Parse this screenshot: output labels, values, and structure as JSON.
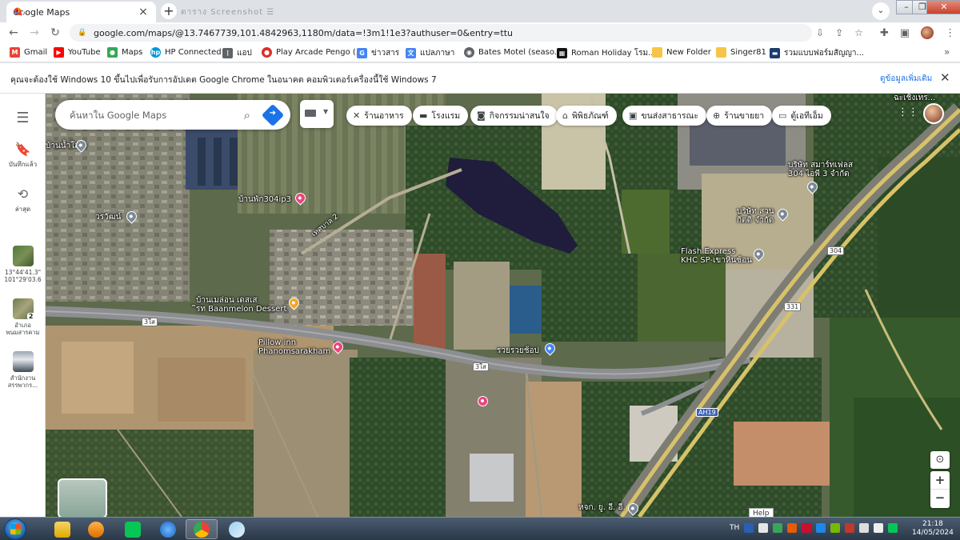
{
  "browser": {
    "tab_title": "Google Maps",
    "url": "google.com/maps/@13.7467739,101.4842963,1180m/data=!3m1!1e3?authuser=0&entry=ttu",
    "ghost_tabs": "ตาราง   Screenshot   ☰"
  },
  "bookmarks": [
    {
      "label": "Gmail",
      "icon": "gmail-icon",
      "color": "#ea4335",
      "glyph": "M"
    },
    {
      "label": "YouTube",
      "icon": "youtube-icon",
      "color": "#ff0000",
      "glyph": "▶"
    },
    {
      "label": "Maps",
      "icon": "maps-icon",
      "color": "#34a853",
      "glyph": "●"
    },
    {
      "label": "HP Connected",
      "icon": "hp-icon",
      "color": "#0096d6",
      "glyph": "hp"
    },
    {
      "label": "แอป",
      "icon": "apps-grid-icon",
      "color": "#5f6368",
      "glyph": "⋮"
    },
    {
      "label": "Play Arcade Pengo (...",
      "icon": "arcade-icon",
      "color": "#d93025",
      "glyph": "●"
    },
    {
      "label": "ข่าวสาร",
      "icon": "news-icon",
      "color": "#4285f4",
      "glyph": "G"
    },
    {
      "label": "แปลภาษา",
      "icon": "translate-icon",
      "color": "#4285f4",
      "glyph": "文"
    },
    {
      "label": "Bates Motel (seaso...",
      "icon": "globe-icon",
      "color": "#5f6368",
      "glyph": "◉"
    },
    {
      "label": "Roman Holiday โรม...",
      "icon": "imdb-icon",
      "color": "#111111",
      "glyph": "▦"
    },
    {
      "label": "New Folder",
      "icon": "folder-icon",
      "color": "#f6c548",
      "glyph": ""
    },
    {
      "label": "Singer81",
      "icon": "folder-icon",
      "color": "#f6c548",
      "glyph": ""
    },
    {
      "label": "รวมแบบฟอร์มสัญญา...",
      "icon": "site-icon",
      "color": "#1b3b6f",
      "glyph": "▬"
    }
  ],
  "infobar": {
    "message": "คุณจะต้องใช้ Windows 10 ขึ้นไปเพื่อรับการอัปเดต Google Chrome ในอนาคต คอมพิวเตอร์เครื่องนี้ใช้ Windows 7",
    "learn_more": "ดูข้อมูลเพิ่มเติม"
  },
  "rail": {
    "saved": "บันทึกแล้ว",
    "recent": "ล่าสุด",
    "recent1_line1": "13°44'41.3\"",
    "recent1_line2": "101°29'03.6",
    "recent2_badge": "2",
    "recent2_line1": "อำเภอ",
    "recent2_line2": "พนมสารคาม",
    "recent3_line1": "สำนักงาน",
    "recent3_line2": "สรรพากร..."
  },
  "search": {
    "placeholder": "ค้นหาใน Google Maps"
  },
  "chips": [
    {
      "label": "ร้านอาหาร",
      "icon": "restaurant-icon",
      "glyph": "🍴"
    },
    {
      "label": "โรงแรม",
      "icon": "hotel-icon",
      "glyph": "🛏"
    },
    {
      "label": "กิจกรรมน่าสนใจ",
      "icon": "camera-icon",
      "glyph": "📷"
    },
    {
      "label": "พิพิธภัณฑ์",
      "icon": "museum-icon",
      "glyph": "🏛"
    },
    {
      "label": "ขนส่งสาธารณะ",
      "icon": "transit-icon",
      "glyph": "🚆"
    },
    {
      "label": "ร้านขายยา",
      "icon": "pharmacy-icon",
      "glyph": "⊕"
    },
    {
      "label": "ตู้เอทีเอ็ม",
      "icon": "atm-icon",
      "glyph": "▭"
    }
  ],
  "map_labels": {
    "top_right": "ฉะเชิงเทร...",
    "baan_nam_sai": "บ้านน้ำใส 4",
    "worawat": "วรวัฒน์",
    "baan_phak": "บ้านพัก304ip3",
    "road_name": "เทศบาล 2",
    "smart_fuel": "บริษัท สมาร์ทเฟลส\n304 ไอพี 3 จำกัด",
    "suan": "บริษัท สวน\nกิตติ จำกัด",
    "flash": "Flash Express\nKHC SP-เขาหินซ้อน",
    "baanmelon": "บ้านเมล่อน เดสเส\nิรท Baanmelon Dessert",
    "pillow": "Pillow inn\nPhanomsarakham",
    "ruay": "รวยรวยช้อป",
    "hoc": "หจก. ยู. อี. อี.",
    "shield_304": "304",
    "shield_331": "331",
    "shield_3": "3ใส",
    "shield_3b": "3ใส",
    "shield_ah19": "AH19",
    "help": "Help"
  },
  "taskbar": {
    "lang": "TH",
    "time": "21:18",
    "date": "14/05/2024"
  }
}
